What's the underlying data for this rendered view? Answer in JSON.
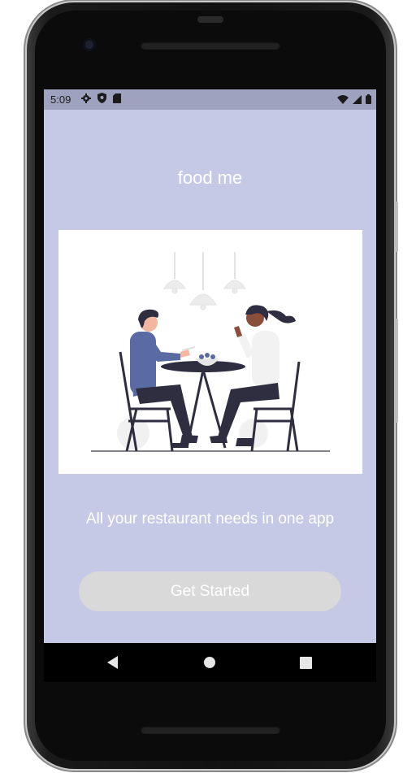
{
  "status_bar": {
    "time": "5:09",
    "left_icons": [
      "gear-icon",
      "shield-icon",
      "sd-card-icon"
    ],
    "right_icons": [
      "wifi-icon",
      "signal-icon",
      "battery-icon"
    ]
  },
  "app": {
    "title": "food me",
    "illustration": "couple-dining-illustration",
    "tagline": "All your restaurant needs in one app",
    "cta_label": "Get Started"
  },
  "nav_bar": {
    "buttons": [
      "back-icon",
      "home-icon",
      "recents-icon"
    ]
  },
  "colors": {
    "screen_background": "#c6c9e6",
    "status_bar": "#9ea2be",
    "button_background": "#d9d9d9",
    "text": "#ffffff"
  }
}
